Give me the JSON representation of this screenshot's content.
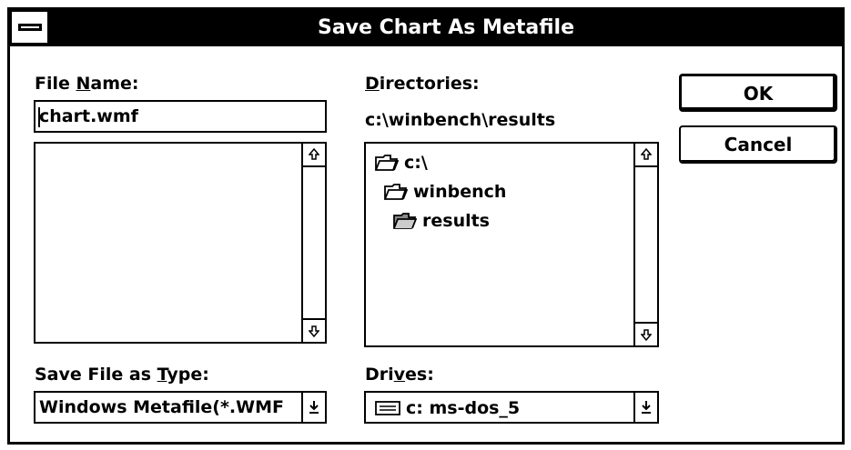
{
  "window": {
    "title": "Save Chart As Metafile"
  },
  "file_name": {
    "label_pre": "File ",
    "label_accel": "N",
    "label_post": "ame:",
    "value": "chart.wmf",
    "files": []
  },
  "directories": {
    "label_accel": "D",
    "label_post": "irectories:",
    "current_path": "c:\\winbench\\results",
    "items": [
      {
        "name": "c:\\",
        "icon": "folder-open-icon"
      },
      {
        "name": "winbench",
        "icon": "folder-open-icon"
      },
      {
        "name": "results",
        "icon": "folder-open-selected-icon"
      }
    ]
  },
  "save_type": {
    "label_pre": "Save File as ",
    "label_accel": "T",
    "label_post": "ype:",
    "value": "Windows Metafile(*.WMF"
  },
  "drives": {
    "label_pre": "Dri",
    "label_accel": "v",
    "label_post": "es:",
    "value": "c: ms-dos_5",
    "icon": "drive-icon"
  },
  "buttons": {
    "ok": "OK",
    "cancel": "Cancel"
  },
  "colors": {
    "title_bg": "#000000",
    "title_fg": "#ffffff",
    "background": "#ffffff"
  }
}
